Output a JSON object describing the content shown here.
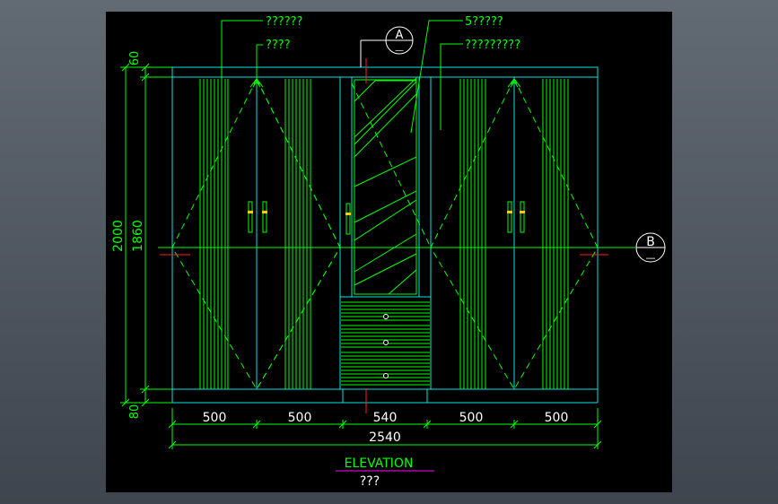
{
  "canvas": {
    "background": "#000000",
    "frame_color": "#4d5560"
  },
  "colors": {
    "cyan": "#00e5e5",
    "green": "#00ff00",
    "red": "#ff2020",
    "white": "#ffffff",
    "magenta": "#ff00ff"
  },
  "callouts": {
    "label1": "??????",
    "label2": "????",
    "label3": "5?????",
    "label4": "?????????"
  },
  "section_markers": {
    "a": "A",
    "b": "B",
    "sub": "—"
  },
  "dimensions": {
    "vertical": {
      "top": "60",
      "middle": "1860",
      "bottom": "80",
      "total": "2000"
    },
    "horizontal": {
      "segments": [
        "500",
        "500",
        "540",
        "500",
        "500"
      ],
      "total": "2540"
    }
  },
  "title": {
    "main": "ELEVATION",
    "sub": "???"
  }
}
